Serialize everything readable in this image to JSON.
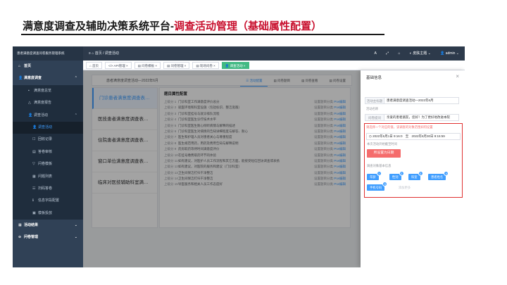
{
  "slide": {
    "title_black": "满意度调查及辅助决策系统平台-",
    "title_red": "调查活动管理（基础属性配置）"
  },
  "topbar": {
    "brand": "患者满意度调查问卷服务管理系统",
    "crumbs": "≡   ⌂ 首页  /  调查活动",
    "letter_a": "A",
    "expand_icon": "⤢",
    "home_icon": "⌂",
    "skin": "◐ 皮肤主题 ⌄",
    "user": "👤 admin ⌄"
  },
  "sidebar": {
    "items": [
      {
        "icon": "⌂",
        "label": "首页",
        "kind": "group"
      },
      {
        "icon": "👤",
        "label": "满意度调查",
        "kind": "group",
        "arrow": "⌃"
      },
      {
        "icon": "▪",
        "label": "满意度总览",
        "kind": "sub"
      },
      {
        "icon": "△",
        "label": "满意度报告",
        "kind": "sub"
      },
      {
        "icon": "👤",
        "label": "调查活动",
        "kind": "sub",
        "arrow": "⌃"
      },
      {
        "icon": "👤",
        "label": "调查活动",
        "kind": "sub2",
        "active": true
      },
      {
        "icon": "☐",
        "label": "回收记录",
        "kind": "sub2"
      },
      {
        "icon": "▤",
        "label": "答卷审核",
        "kind": "sub2"
      },
      {
        "icon": "▽",
        "label": "问卷模板",
        "kind": "sub2"
      },
      {
        "icon": "▦",
        "label": "问题列表",
        "kind": "sub2"
      },
      {
        "icon": "☷",
        "label": "扫码答卷",
        "kind": "sub2"
      },
      {
        "icon": "ℹ",
        "label": "信息字段配置",
        "kind": "sub2"
      },
      {
        "icon": "▣",
        "label": "模板投放",
        "kind": "sub2"
      },
      {
        "icon": "▦",
        "label": "活动结果",
        "kind": "group",
        "arrow": "⌄"
      },
      {
        "icon": "⊙",
        "label": "问卷管理",
        "kind": "group",
        "arrow": "⌄"
      }
    ]
  },
  "tabs": [
    {
      "label": "⌂ 首页",
      "active": false
    },
    {
      "label": "</> API管理 ×",
      "active": false
    },
    {
      "label": "▤ 问卷模板 ×",
      "active": false
    },
    {
      "label": "▤ 问卷管理 ×",
      "active": false
    },
    {
      "label": "▤ 现场问卷 ×",
      "active": false
    },
    {
      "label": "👤 调查活动 ×",
      "active": true
    }
  ],
  "survey_head": {
    "name": "患者满意度调查活动—2022年6月",
    "buttons": [
      {
        "label": "☰ 活动配置",
        "on": true
      },
      {
        "label": "▤ 问卷题目",
        "on": false
      },
      {
        "label": "▤ 问卷查看",
        "on": false
      },
      {
        "label": "▤ 问卷设置",
        "on": false
      }
    ]
  },
  "survey_list": [
    {
      "label": "门诊患者满意度调查表…",
      "active": true
    },
    {
      "label": "医技患者满意度调查表…",
      "active": false
    },
    {
      "label": "住院患者满意度调查表…",
      "active": false
    },
    {
      "label": "窗口单位满意度调查表…",
      "active": false
    },
    {
      "label": "临床对医技辅助科室满…",
      "active": false
    }
  ],
  "question_panel": {
    "title": "题目属性配置",
    "rows": [
      {
        "num": "上级分 1",
        "text": "门诊科室工作满意度评价总分",
        "action_a": "设置题目分类",
        "action_b": "Prw编辑"
      },
      {
        "num": "上级分 2",
        "text": "就医环境和科室设施（包括标识、整洁宽敞）",
        "action_a": "设置题目分类",
        "action_b": "Prw编辑"
      },
      {
        "num": "上级分 3",
        "text": "门诊科室挂号与就诊排队流程",
        "action_a": "设置题目分类",
        "action_b": "Prw编辑"
      },
      {
        "num": "上级分 4",
        "text": "门诊科室医生诊疗技术水平",
        "action_a": "设置题目分类",
        "action_b": "Prw编辑"
      },
      {
        "num": "上级分 5",
        "text": "门诊科室医生耐心倾听病情与解释的描述",
        "action_a": "设置题目分类",
        "action_b": "Prw编辑"
      },
      {
        "num": "上级分 6",
        "text": "门诊科室医生对病情的告知详细程度与解答、耐心",
        "action_a": "设置题目分类",
        "action_b": "Prw编辑"
      },
      {
        "num": "上级分 7",
        "text": "医生和护理人员对患者关心与尊重程度",
        "action_a": "设置题目分类",
        "action_b": "Prw编辑"
      },
      {
        "num": "上级分 8",
        "text": "医生规范用药，用药及费用告知与解释说明",
        "action_a": "设置题目分类",
        "action_b": "Prw编辑"
      },
      {
        "num": "上级分 9",
        "text": "药房取药等待时间满意度评价",
        "action_a": "设置题目分类",
        "action_b": "Prw编辑"
      },
      {
        "num": "上级分 10",
        "text": "在挂号缴费取药环节的体验",
        "action_a": "设置题目分类",
        "action_b": "Prw编辑"
      },
      {
        "num": "上级分 11",
        "text": "如有建议，对医护人员工作流程和其它方面，能接受短信回访调查或表扬",
        "action_a": "设置题目分类",
        "action_b": "Prw编辑"
      },
      {
        "num": "上级分 12",
        "text": "如有建议，对医院的服务和建议（门诊科室）",
        "action_a": "设置题目分类",
        "action_b": "Prw编辑"
      },
      {
        "num": "上级分 13",
        "text": "卫生间保洁打扫干净整洁",
        "action_a": "设置题目分类",
        "action_b": "Prw编辑"
      },
      {
        "num": "上级分 14",
        "text": "卫生间保洁打扫干净整洁",
        "action_a": "设置题目分类",
        "action_b": "Prw编辑"
      },
      {
        "num": "上级分 15",
        "text": "导医服务和相关人员工作态度好",
        "action_a": "设置题目分类",
        "action_b": "Prw编辑"
      }
    ]
  },
  "drawer": {
    "title": "基础信息",
    "close": "×",
    "activity_label": "活动主标题",
    "activity_value": "患者满意度调查活动—2022年6月",
    "desc_label": "活动名称",
    "intro_label": "问卷提问",
    "intro_value": "亲爱的患者朋友，您好！为了更好地改进本院",
    "hint": "请选择一个对应的值，该调查的对象范围如何设置",
    "date_start": "◷  2022年6月1日 9:16:0",
    "date_sep": "至",
    "date_end": "2022年6月30日 9:15:59",
    "valid_label": "本次活动开始截至时间",
    "red_button": "所设置为日期",
    "attr_label": "调查对象基本信息",
    "chips": [
      {
        "label": "年龄",
        "badge": "1"
      },
      {
        "label": "性别",
        "badge": "2"
      },
      {
        "label": "科室",
        "badge": "3"
      },
      {
        "label": "患者姓名",
        "badge": "4"
      },
      {
        "label": "手机号码",
        "badge": "5"
      }
    ],
    "add_more": "添加更多"
  }
}
